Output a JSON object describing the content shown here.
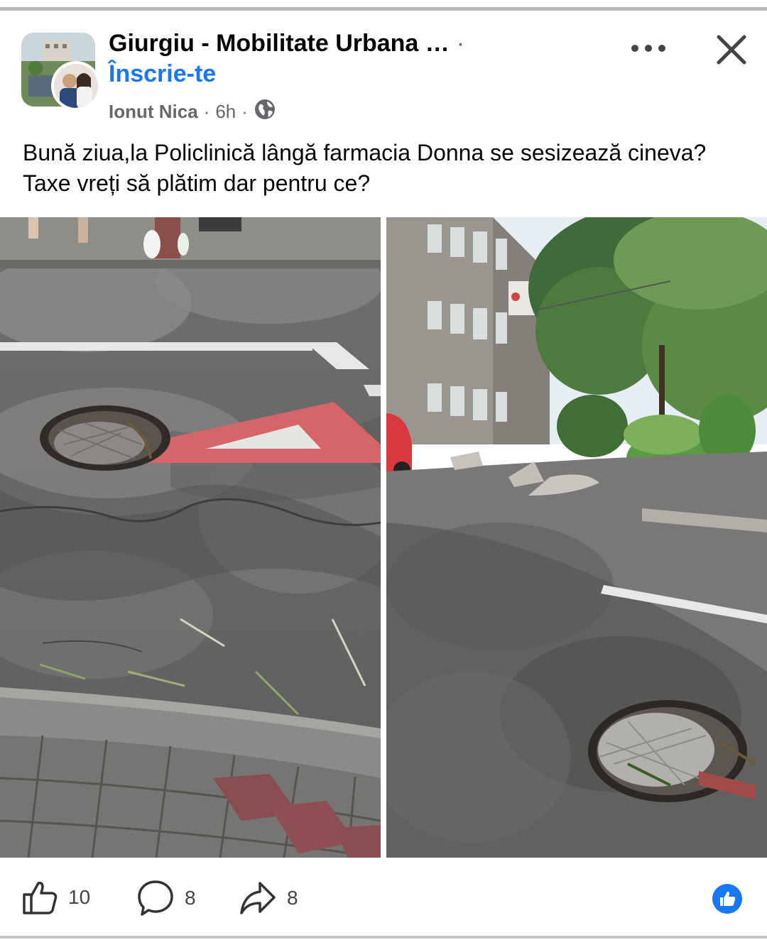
{
  "post": {
    "group_name": "Giurgiu - Mobilitate Urbana …",
    "join_label": "Înscrie-te",
    "author": "Ionut Nica",
    "time": "6h",
    "text": "Bună ziua,la Policlinică lângă farmacia Donna se sesizează cineva?Taxe vreți să plătim dar pentru ce?"
  },
  "actions": {
    "likes": "10",
    "comments": "8",
    "shares": "8"
  },
  "icons": {
    "more": "more-horizontal-icon",
    "close": "close-icon",
    "privacy": "globe-icon",
    "like": "thumbs-up-icon",
    "comment": "comment-icon",
    "share": "share-icon",
    "reaction": "like-reaction-icon"
  },
  "colors": {
    "accent": "#1877f2",
    "secondary_text": "#65676b"
  }
}
